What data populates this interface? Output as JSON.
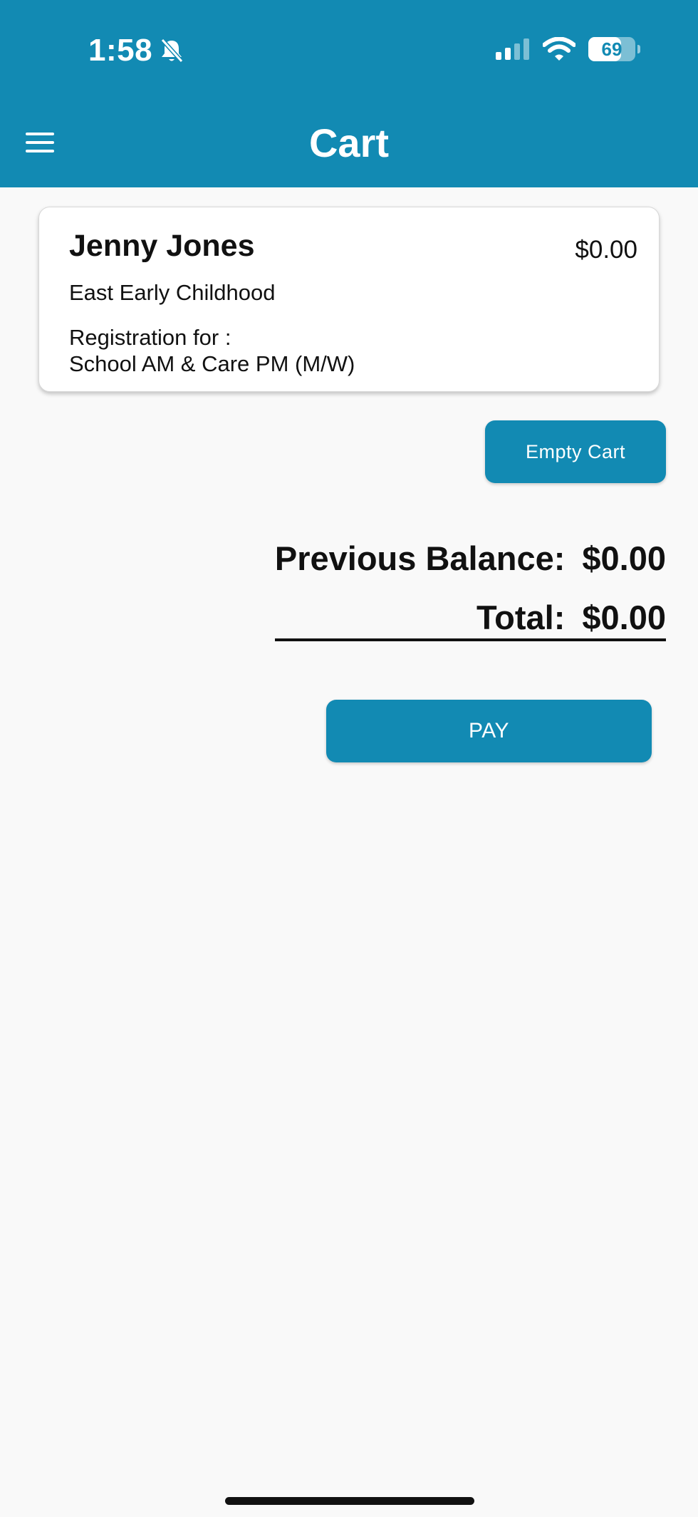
{
  "status_bar": {
    "time": "1:58",
    "battery_level": "69",
    "battery_fraction": 0.69
  },
  "app_bar": {
    "title": "Cart"
  },
  "cart_item": {
    "name": "Jenny Jones",
    "price": "$0.00",
    "school": "East Early Childhood",
    "registration_label": "Registration for :",
    "registration_program": "School AM & Care PM (M/W)"
  },
  "actions": {
    "empty_cart_label": "Empty Cart",
    "pay_label": "PAY"
  },
  "totals": {
    "previous_balance_label": "Previous Balance:",
    "previous_balance_value": "$0.00",
    "total_label": "Total:",
    "total_value": "$0.00"
  },
  "colors": {
    "primary": "#128ab3",
    "background": "#f9f9f9"
  }
}
